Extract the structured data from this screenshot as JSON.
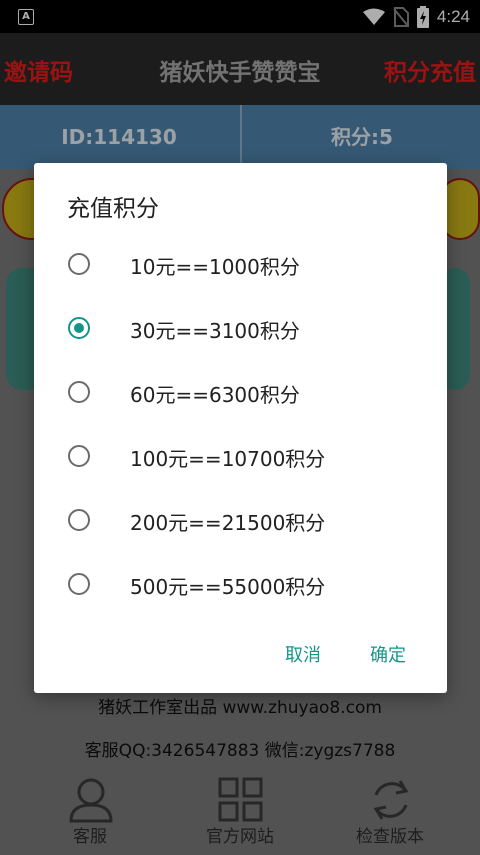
{
  "statusbar": {
    "notification_icon": "A",
    "time": "4:24"
  },
  "header": {
    "left_label": "邀请码",
    "title": "猪妖快手赞赞宝",
    "right_label": "积分充值"
  },
  "info": {
    "id": "ID:114130",
    "score": "积分:5"
  },
  "footer": {
    "line1": "猪妖工作室出品 www.zhuyao8.com",
    "line2": "客服QQ:3426547883 微信:zygzs7788"
  },
  "nav": {
    "items": [
      {
        "label": "客服",
        "icon": "person-icon"
      },
      {
        "label": "官方网站",
        "icon": "grid-icon"
      },
      {
        "label": "检查版本",
        "icon": "refresh-icon"
      }
    ]
  },
  "dialog": {
    "title": "充值积分",
    "selected_index": 1,
    "options": [
      {
        "label": "10元==1000积分"
      },
      {
        "label": "30元==3100积分"
      },
      {
        "label": "60元==6300积分"
      },
      {
        "label": "100元==10700积分"
      },
      {
        "label": "200元==21500积分"
      },
      {
        "label": "500元==55000积分"
      }
    ],
    "cancel_label": "取消",
    "ok_label": "确定"
  },
  "colors": {
    "accent": "#159588",
    "header_red": "#e31b1b",
    "info_blue": "#4e84ad"
  }
}
